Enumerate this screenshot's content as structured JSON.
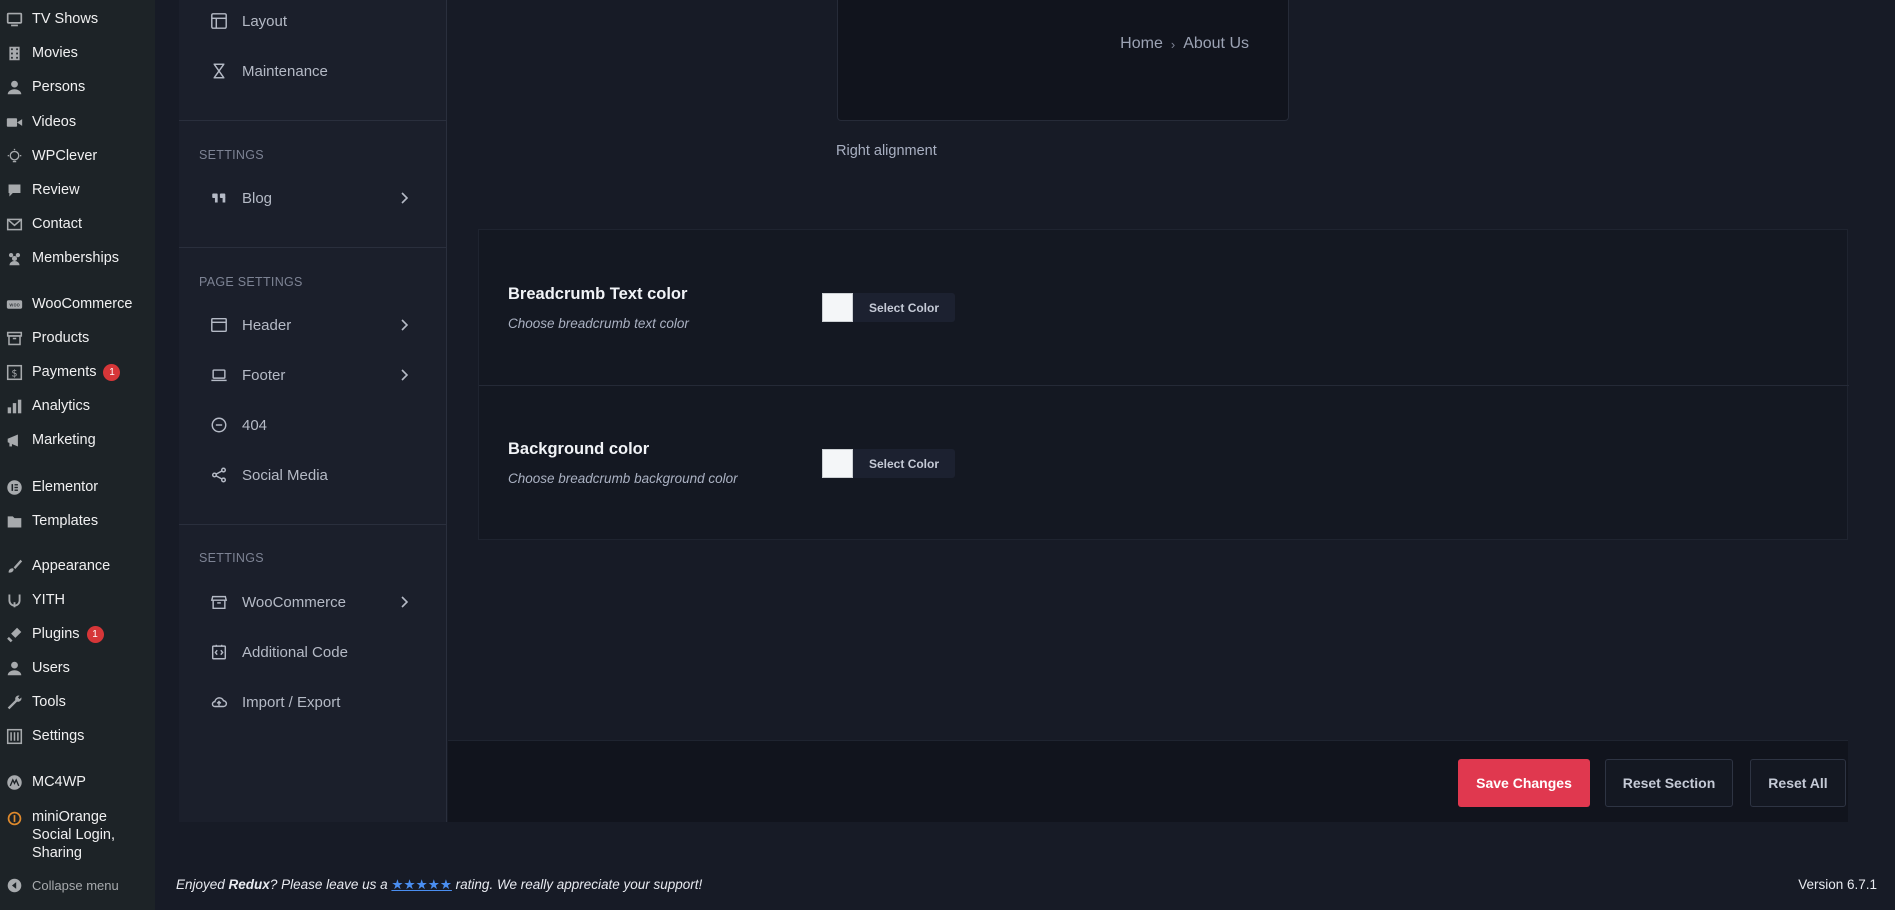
{
  "wp_menu": [
    {
      "label": "TV Shows",
      "icon": "tv-icon"
    },
    {
      "label": "Movies",
      "icon": "film-icon"
    },
    {
      "label": "Persons",
      "icon": "person-icon"
    },
    {
      "label": "Videos",
      "icon": "video-icon"
    },
    {
      "label": "WPClever",
      "icon": "bulb-icon"
    },
    {
      "label": "Review",
      "icon": "comment-icon"
    },
    {
      "label": "Contact",
      "icon": "mail-icon"
    },
    {
      "label": "Memberships",
      "icon": "group-icon"
    },
    {
      "label": "WooCommerce",
      "icon": "woo-icon"
    },
    {
      "label": "Products",
      "icon": "archive-icon"
    },
    {
      "label": "Payments",
      "icon": "dollar-icon",
      "badge": "1"
    },
    {
      "label": "Analytics",
      "icon": "bar-chart-icon"
    },
    {
      "label": "Marketing",
      "icon": "megaphone-icon"
    },
    {
      "label": "Elementor",
      "icon": "elementor-icon"
    },
    {
      "label": "Templates",
      "icon": "folder-icon"
    },
    {
      "label": "Appearance",
      "icon": "brush-icon"
    },
    {
      "label": "YITH",
      "icon": "yith-icon"
    },
    {
      "label": "Plugins",
      "icon": "plug-icon",
      "badge": "1"
    },
    {
      "label": "Users",
      "icon": "user-icon"
    },
    {
      "label": "Tools",
      "icon": "wrench-icon"
    },
    {
      "label": "Settings",
      "icon": "settings-icon"
    },
    {
      "label": "MC4WP",
      "icon": "mc4wp-icon"
    },
    {
      "label": "miniOrange Social Login, Sharing",
      "lines": [
        "miniOrange",
        "Social Login,",
        "Sharing"
      ],
      "icon": "miniorange-icon"
    },
    {
      "label": "Collapse menu",
      "icon": "collapse-icon"
    }
  ],
  "redux_nav": {
    "items_top": [
      {
        "label": "Layout",
        "icon": "layout-icon"
      },
      {
        "label": "Maintenance",
        "icon": "hourglass-icon"
      }
    ],
    "heading_settings_1": "SETTINGS",
    "blog": {
      "label": "Blog",
      "icon": "quote-icon"
    },
    "heading_page_settings": "PAGE SETTINGS",
    "page_items": [
      {
        "label": "Header",
        "icon": "window-icon",
        "chevron": true
      },
      {
        "label": "Footer",
        "icon": "laptop-icon",
        "chevron": true
      },
      {
        "label": "404",
        "icon": "minus-circle-icon",
        "chevron": false
      },
      {
        "label": "Social Media",
        "icon": "share-icon",
        "chevron": false
      }
    ],
    "heading_settings_2": "SETTINGS",
    "bottom_items": [
      {
        "label": "WooCommerce",
        "icon": "store-icon",
        "chevron": true
      },
      {
        "label": "Additional Code",
        "icon": "code-icon",
        "chevron": false
      },
      {
        "label": "Import / Export",
        "icon": "cloud-icon",
        "chevron": false
      }
    ]
  },
  "preview": {
    "crumb_home": "Home",
    "crumb_separator": "›",
    "crumb_current": "About Us",
    "alignment_label": "Right alignment"
  },
  "fields": {
    "text_color": {
      "title": "Breadcrumb Text color",
      "description": "Choose breadcrumb text color",
      "button": "Select Color",
      "swatch": "#f4f6f8"
    },
    "background_color": {
      "title": "Background color",
      "description": "Choose breadcrumb background color",
      "button": "Select Color",
      "swatch": "#f4f6f8"
    }
  },
  "actions": {
    "save": "Save Changes",
    "reset_section": "Reset Section",
    "reset_all": "Reset All"
  },
  "footer": {
    "note_prefix": "Enjoyed ",
    "note_brand": "Redux",
    "note_middle": "? Please leave us a ",
    "note_stars": "★★★★★",
    "note_suffix": " rating. We really appreciate your support!",
    "version": "Version 6.7.1"
  },
  "colors": {
    "accent": "#e0384f",
    "badge": "#d63638",
    "background": "#171b26"
  }
}
